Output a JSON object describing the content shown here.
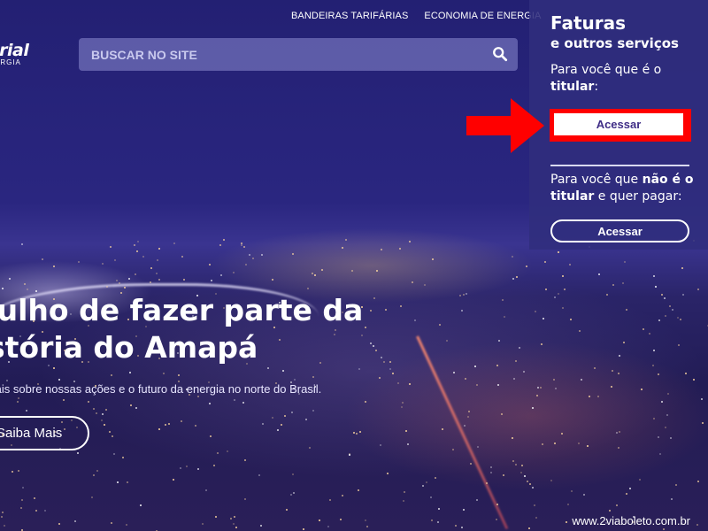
{
  "nav": {
    "links": [
      "BANDEIRAS TARIFÁRIAS",
      "ECONOMIA DE ENERGIA"
    ]
  },
  "logo": {
    "word": "torial",
    "sub": "ERGIA"
  },
  "search": {
    "placeholder": "BUSCAR NO SITE",
    "icon": "search-icon"
  },
  "hero": {
    "title_line1": "gulho de fazer parte da",
    "title_line2": "stória do Amapá",
    "subtitle": "a mais sobre nossas ações e o futuro da energia no norte do Brasil.",
    "button_label": "Saiba Mais"
  },
  "panel": {
    "title": "Faturas",
    "subtitle": "e outros serviços",
    "holder_text": "Para você que é o",
    "holder_bold": "titular",
    "holder_suffix": ":",
    "holder_button": "Acessar",
    "nonholder_text": "Para você que",
    "nonholder_bold1": "não é o",
    "nonholder_bold2": "titular",
    "nonholder_suffix": "e quer pagar:",
    "nonholder_button": "Acessar"
  },
  "annotation": {
    "color": "#ff0000",
    "icon": "red-arrow-icon"
  },
  "watermark": "www.2viaboleto.com.br"
}
